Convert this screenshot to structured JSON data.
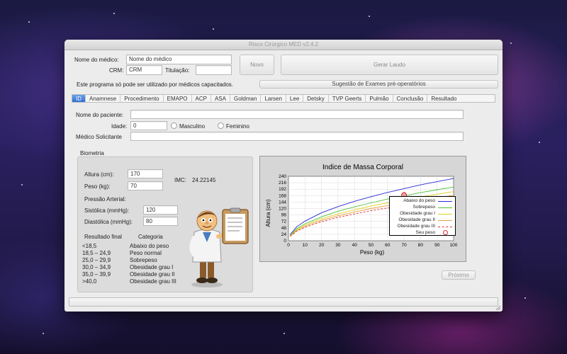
{
  "window": {
    "title": "Risco Cirúrgico MED v2.4.2"
  },
  "header": {
    "medico_label": "Nome do médico:",
    "medico_value": "Nome do médico",
    "crm_label": "CRM:",
    "crm_value": "CRM",
    "titulacao_label": "Titulação:",
    "titulacao_value": "",
    "novo_button": "Novo",
    "gerar_button": "Gerar Laudo",
    "notice": "Este programa só pode ser utilizado por médicos capacitados.",
    "sugestao_button": "Sugestão de Exames pré-operatórios"
  },
  "tabs": [
    {
      "label": "ID",
      "active": true
    },
    {
      "label": "Anamnese"
    },
    {
      "label": "Procedimento"
    },
    {
      "label": "EMAPO"
    },
    {
      "label": "ACP"
    },
    {
      "label": "ASA"
    },
    {
      "label": "Goldman"
    },
    {
      "label": "Larsen"
    },
    {
      "label": "Lee"
    },
    {
      "label": "Detsky"
    },
    {
      "label": "TVP Geerts"
    },
    {
      "label": "Pulmão"
    },
    {
      "label": "Conclusão"
    },
    {
      "label": "Resultado"
    }
  ],
  "patient": {
    "nome_label": "Nome do paciente:",
    "nome_value": "",
    "idade_label": "Idade:",
    "idade_value": "0",
    "masculino_label": "Masculino",
    "feminino_label": "Feminino",
    "solicitante_label": "Médico Solicitante",
    "solicitante_value": ""
  },
  "biometria": {
    "title": "Biometria",
    "altura_label": "Altura (cm):",
    "altura_value": "170",
    "peso_label": "Peso (kg):",
    "peso_value": "70",
    "imc_label": "IMC:",
    "imc_value": "24.22145",
    "pressao_label": "Pressão Arterial:",
    "sistolica_label": "Sistólica (mmHg):",
    "sistolica_value": "120",
    "diastolica_label": "Diastólica (mmHg):",
    "diastolica_value": "80",
    "resultado_header": "Resultado final",
    "categoria_header": "Categoria",
    "table": [
      {
        "range": "<18,5",
        "category": "Abaixo do peso"
      },
      {
        "range": "18,5 – 24,9",
        "category": "Peso normal"
      },
      {
        "range": "25,0 – 29,9",
        "category": "Sobrepeso"
      },
      {
        "range": "30,0 – 34,9",
        "category": "Obesidade grau I"
      },
      {
        "range": "35,0 – 39,9",
        "category": "Obesidade grau II"
      },
      {
        "range": ">40,0",
        "category": "Obesidade grau III"
      }
    ]
  },
  "proximo_button": "Próximo",
  "icons": {
    "doctor": "doctor-clipboard-icon"
  },
  "chart_data": {
    "type": "line",
    "title": "Indice de Massa Corporal",
    "xlabel": "Peso (kg)",
    "ylabel": "Altura (cm)",
    "xlim": [
      0,
      100
    ],
    "ylim": [
      0,
      240
    ],
    "xticks": [
      0,
      10,
      20,
      30,
      40,
      50,
      60,
      70,
      80,
      90,
      100
    ],
    "yticks": [
      0,
      24,
      48,
      72,
      96,
      120,
      144,
      168,
      192,
      216,
      240
    ],
    "grid": true,
    "legend_position": "bottom-right",
    "x": [
      1,
      5,
      10,
      20,
      30,
      40,
      50,
      60,
      70,
      80,
      90,
      100
    ],
    "series": [
      {
        "name": "Abaixo do peso",
        "color": "#2b2bd8",
        "values": [
          23,
          52,
          73,
          104,
          127,
          147,
          164,
          180,
          194,
          208,
          220,
          232
        ]
      },
      {
        "name": "Sobrepeso",
        "color": "#4cc23c",
        "values": [
          20,
          45,
          63,
          89,
          110,
          126,
          141,
          155,
          167,
          179,
          190,
          200
        ]
      },
      {
        "name": "Obesidade grau I",
        "color": "#e0d020",
        "values": [
          18,
          41,
          58,
          82,
          100,
          115,
          129,
          141,
          153,
          163,
          173,
          183
        ]
      },
      {
        "name": "Obesidade grau II",
        "color": "#e0a040",
        "values": [
          17,
          38,
          54,
          76,
          93,
          107,
          120,
          131,
          141,
          151,
          160,
          169
        ]
      },
      {
        "name": "Obesidade grau III",
        "color": "#e03030",
        "dashed": true,
        "values": [
          16,
          35,
          50,
          71,
          87,
          100,
          112,
          122,
          132,
          141,
          150,
          158
        ]
      }
    ],
    "point": {
      "name": "Seu peso",
      "x": 70,
      "y": 170,
      "color": "#d03030"
    }
  }
}
